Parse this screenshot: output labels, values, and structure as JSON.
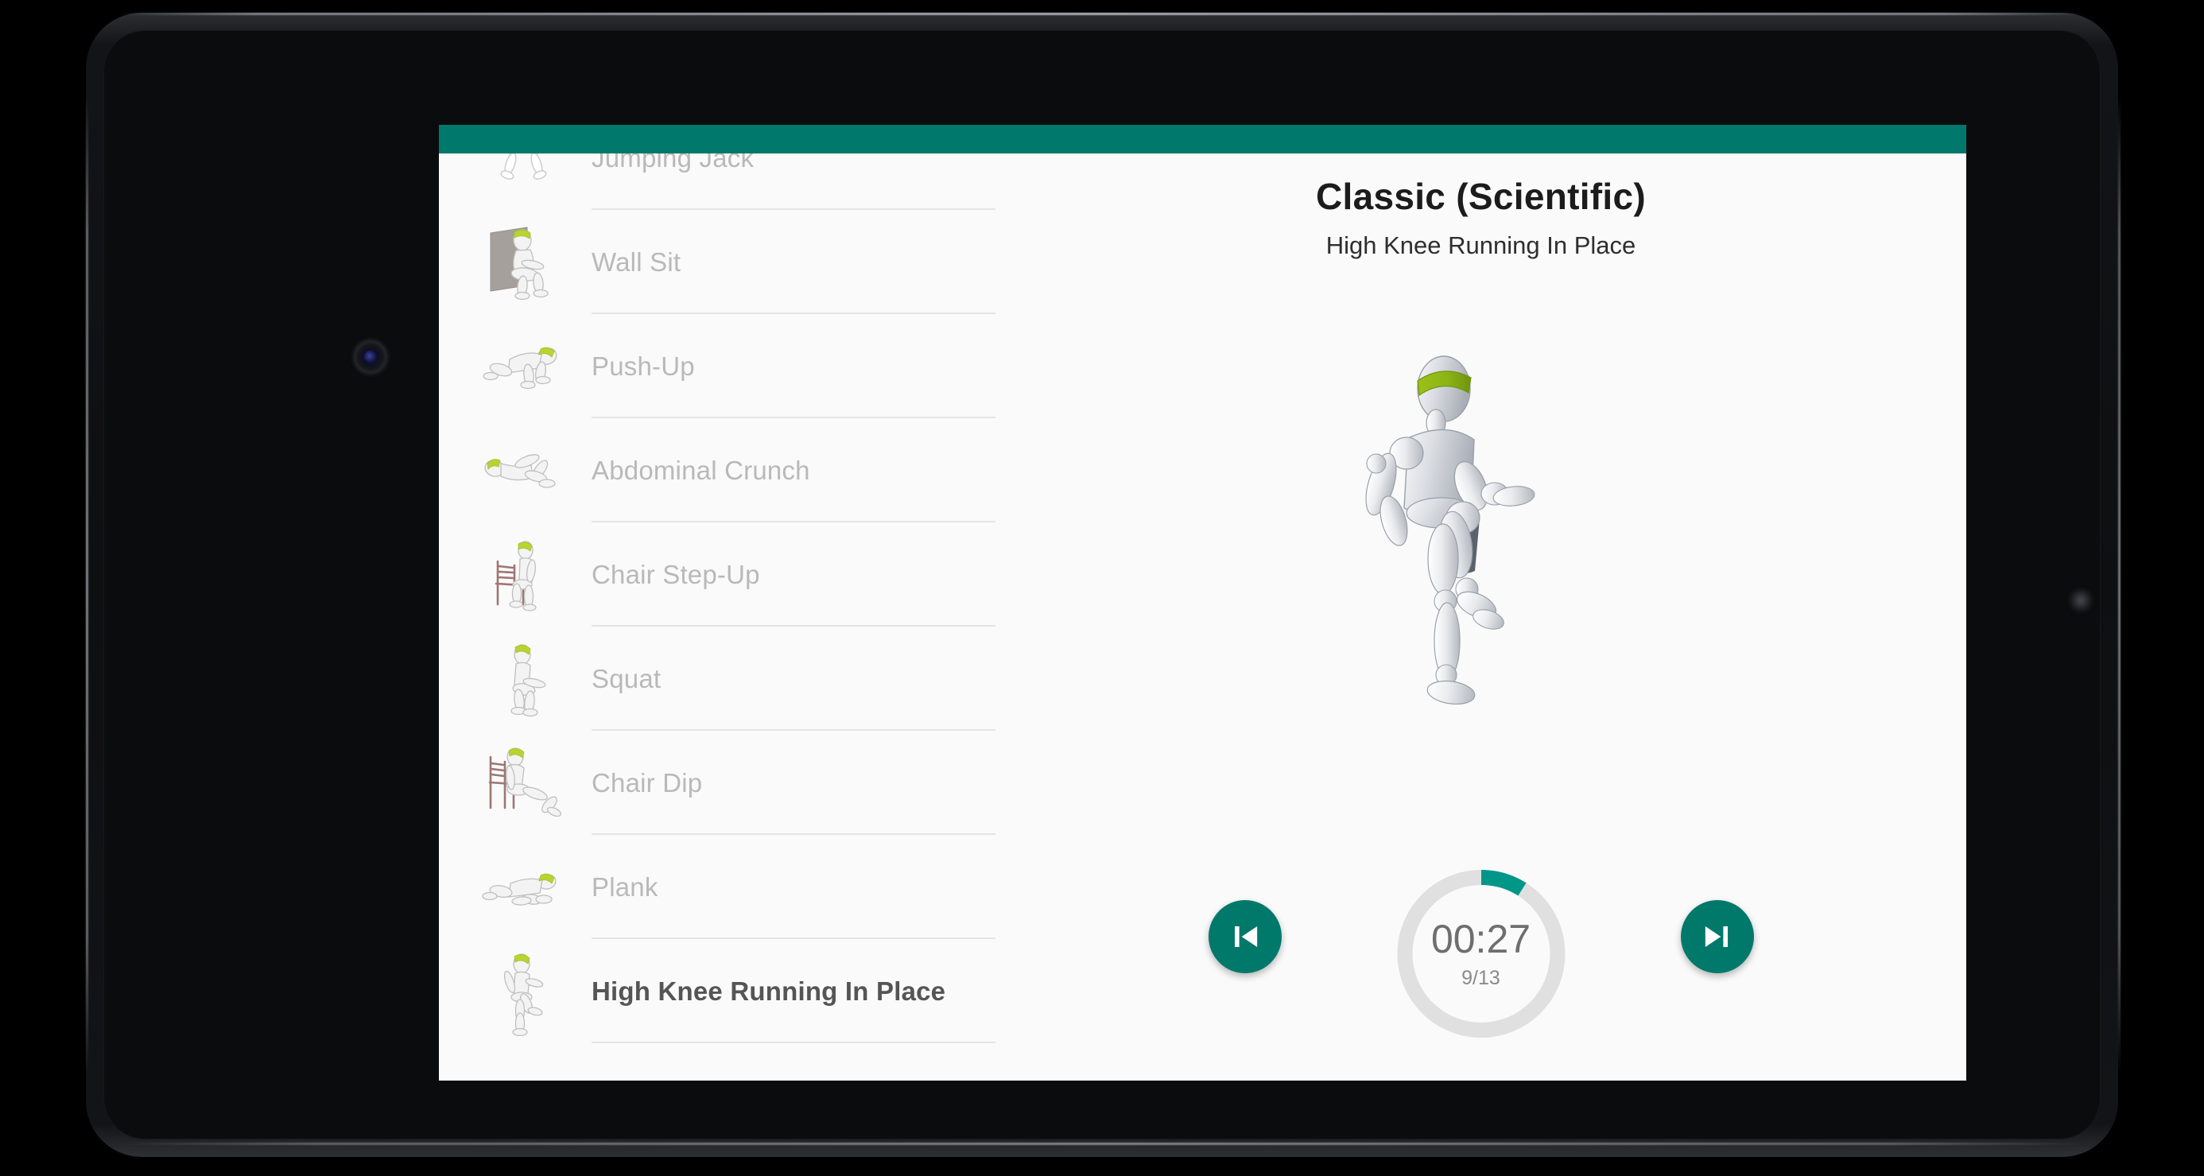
{
  "app": {
    "toolbar_color": "#00786b",
    "surface_color": "#fafafa"
  },
  "exercise_list": {
    "items": [
      {
        "label": "Jumping Jack",
        "icon": "exercise-jumping-jack-icon",
        "active": false,
        "partially_visible": true
      },
      {
        "label": "Wall Sit",
        "icon": "exercise-wall-sit-icon",
        "active": false
      },
      {
        "label": "Push-Up",
        "icon": "exercise-push-up-icon",
        "active": false
      },
      {
        "label": "Abdominal Crunch",
        "icon": "exercise-abdominal-crunch-icon",
        "active": false
      },
      {
        "label": "Chair Step-Up",
        "icon": "exercise-chair-step-up-icon",
        "active": false
      },
      {
        "label": "Squat",
        "icon": "exercise-squat-icon",
        "active": false
      },
      {
        "label": "Chair Dip",
        "icon": "exercise-chair-dip-icon",
        "active": false
      },
      {
        "label": "Plank",
        "icon": "exercise-plank-icon",
        "active": false
      },
      {
        "label": "High Knee Running In Place",
        "icon": "exercise-high-knee-running-icon",
        "active": true
      }
    ]
  },
  "player": {
    "workout_title": "Classic (Scientific)",
    "current_exercise": "High Knee Running In Place",
    "animation_icon": "high-knee-running-mannequin",
    "timer": {
      "remaining": "00:27",
      "progress_count": "9/13",
      "step_current": 9,
      "step_total": 13,
      "arc_percent": 9,
      "arc_color": "#009688",
      "track_color": "#e0e0e0"
    },
    "controls": {
      "previous_icon": "skip-previous-icon",
      "next_icon": "skip-next-icon",
      "button_color": "#00796b"
    }
  },
  "device": {
    "front_camera_icon": "front-camera-icon",
    "ambient_sensor_icon": "ambient-light-sensor-icon"
  }
}
